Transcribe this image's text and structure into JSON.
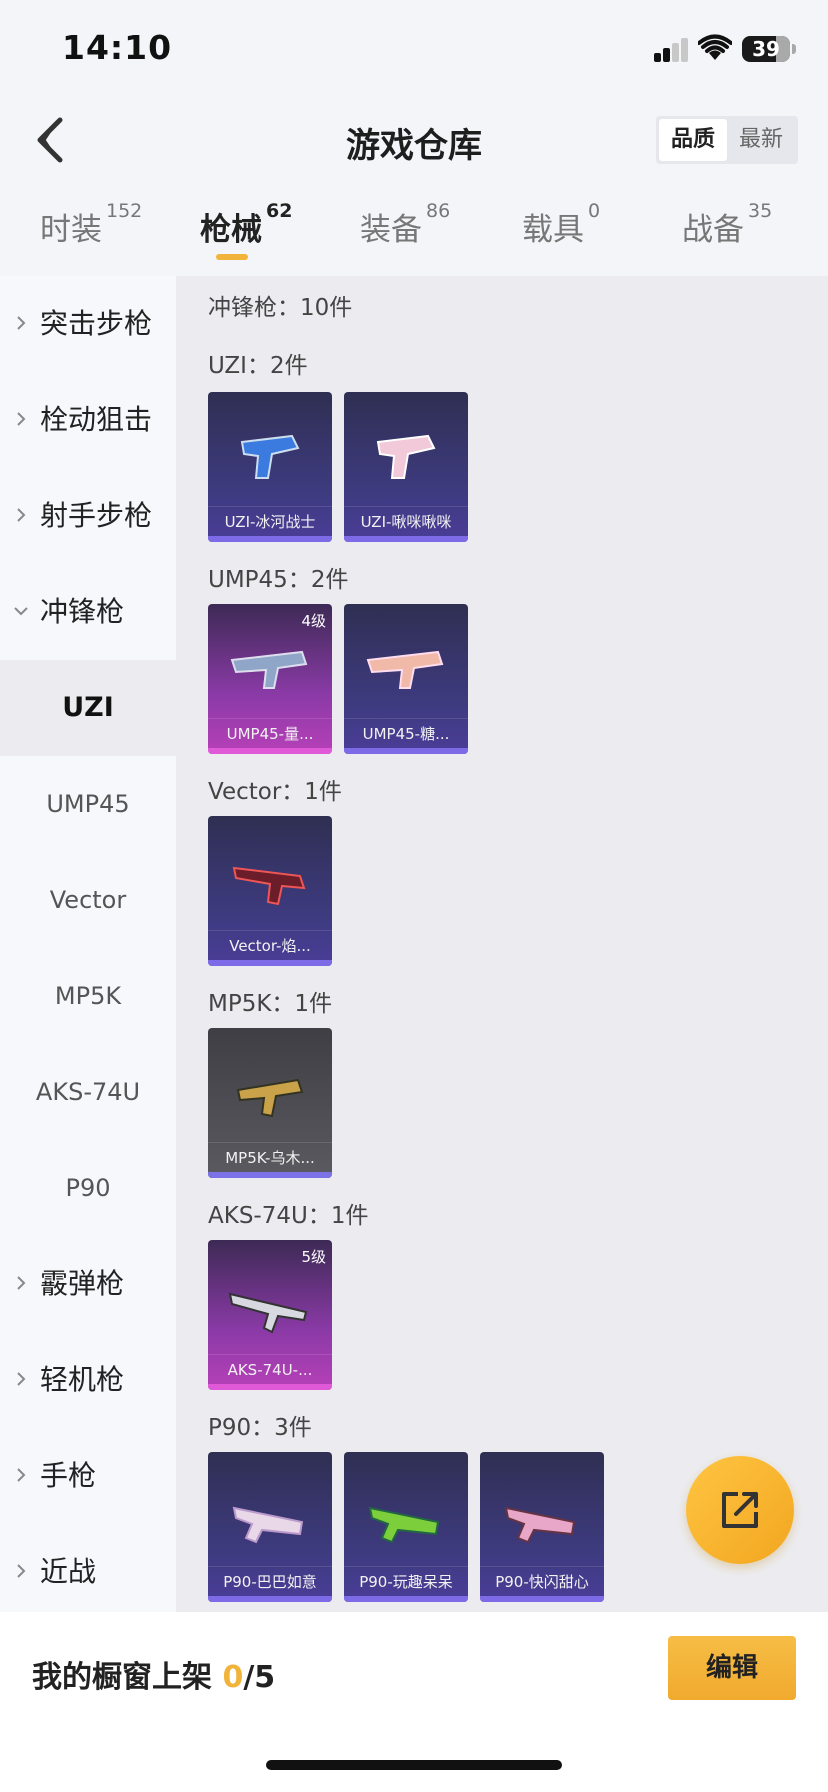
{
  "status_bar": {
    "time": "14:10",
    "battery": "39"
  },
  "header": {
    "title": "游戏仓库",
    "sort_options": [
      "品质",
      "最新"
    ],
    "active_sort": "品质"
  },
  "tabs": [
    {
      "label": "时装",
      "count": "152"
    },
    {
      "label": "枪械",
      "count": "62"
    },
    {
      "label": "装备",
      "count": "86"
    },
    {
      "label": "载具",
      "count": "0"
    },
    {
      "label": "战备",
      "count": "35"
    }
  ],
  "sidebar": {
    "categories_before": [
      "突击步枪",
      "栓动狙击",
      "射手步枪",
      "冲锋枪"
    ],
    "subitems": [
      "UZI",
      "UMP45",
      "Vector",
      "MP5K",
      "AKS-74U",
      "P90"
    ],
    "active_subitem": "UZI",
    "categories_after": [
      "霰弹枪",
      "轻机枪",
      "手枪",
      "近战"
    ]
  },
  "main": {
    "group_title": "冲锋枪：10件",
    "sections": [
      {
        "title": "UZI：2件",
        "items": [
          {
            "name": "UZI-冰河战士",
            "rarity": "purple",
            "level": ""
          },
          {
            "name": "UZI-啾咪啾咪",
            "rarity": "purple",
            "level": ""
          }
        ]
      },
      {
        "title": "UMP45：2件",
        "items": [
          {
            "name": "UMP45-量...",
            "rarity": "pink",
            "level": "4级"
          },
          {
            "name": "UMP45-糖...",
            "rarity": "purple",
            "level": ""
          }
        ]
      },
      {
        "title": "Vector：1件",
        "items": [
          {
            "name": "Vector-焰...",
            "rarity": "purple",
            "level": ""
          }
        ]
      },
      {
        "title": "MP5K：1件",
        "items": [
          {
            "name": "MP5K-乌木...",
            "rarity": "gray",
            "level": ""
          }
        ]
      },
      {
        "title": "AKS-74U：1件",
        "items": [
          {
            "name": "AKS-74U-...",
            "rarity": "pink",
            "level": "5级"
          }
        ]
      },
      {
        "title": "P90：3件",
        "items": [
          {
            "name": "P90-巴巴如意",
            "rarity": "purple",
            "level": ""
          },
          {
            "name": "P90-玩趣呆呆",
            "rarity": "purple",
            "level": ""
          },
          {
            "name": "P90-快闪甜心",
            "rarity": "purple",
            "level": ""
          }
        ]
      }
    ]
  },
  "bottom": {
    "label": "我的橱窗上架",
    "current": "0",
    "total": "/5",
    "edit_label": "编辑"
  },
  "colors": {
    "accent": "#f2b33a",
    "purple_card": "#3f3b82",
    "pink_card": "#b740b8"
  }
}
